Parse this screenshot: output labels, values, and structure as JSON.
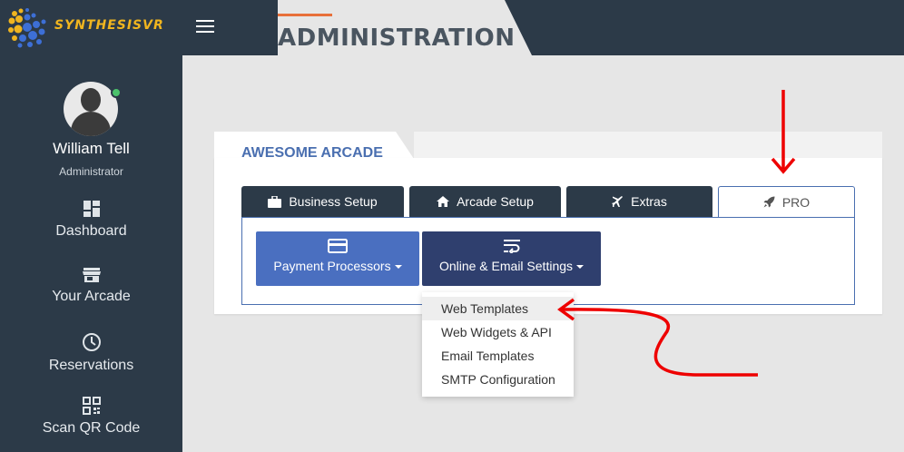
{
  "brand": {
    "name": "SYNTHESISVR"
  },
  "page": {
    "title": "ADMINISTRATION"
  },
  "user": {
    "name": "William Tell",
    "role": "Administrator"
  },
  "sidebar": {
    "items": [
      {
        "label": "Dashboard",
        "icon": "dashboard-icon"
      },
      {
        "label": "Your Arcade",
        "icon": "store-icon"
      },
      {
        "label": "Reservations",
        "icon": "clock-icon"
      },
      {
        "label": "Scan QR Code",
        "icon": "qr-code-icon"
      }
    ]
  },
  "card": {
    "title": "AWESOME ARCADE"
  },
  "tabs": [
    {
      "label": "Business Setup",
      "icon": "briefcase-icon"
    },
    {
      "label": "Arcade Setup",
      "icon": "home-icon"
    },
    {
      "label": "Extras",
      "icon": "plane-icon"
    },
    {
      "label": "PRO",
      "icon": "rocket-icon",
      "active": true
    }
  ],
  "buttons": [
    {
      "label": "Payment Processors",
      "icon": "credit-card-icon"
    },
    {
      "label": "Online & Email Settings",
      "icon": "wrap-text-icon"
    }
  ],
  "dropdown": {
    "items": [
      "Web Templates",
      "Web Widgets & API",
      "Email Templates",
      "SMTP Configuration"
    ]
  },
  "colors": {
    "sidebar_bg": "#2c3a48",
    "brand_yellow": "#f0b51f",
    "accent_orange": "#e8703a",
    "blue_button": "#4a6fc0",
    "navy_button": "#2f3f6e",
    "annotation_red": "#ee0000",
    "online_green": "#4cc36c"
  }
}
